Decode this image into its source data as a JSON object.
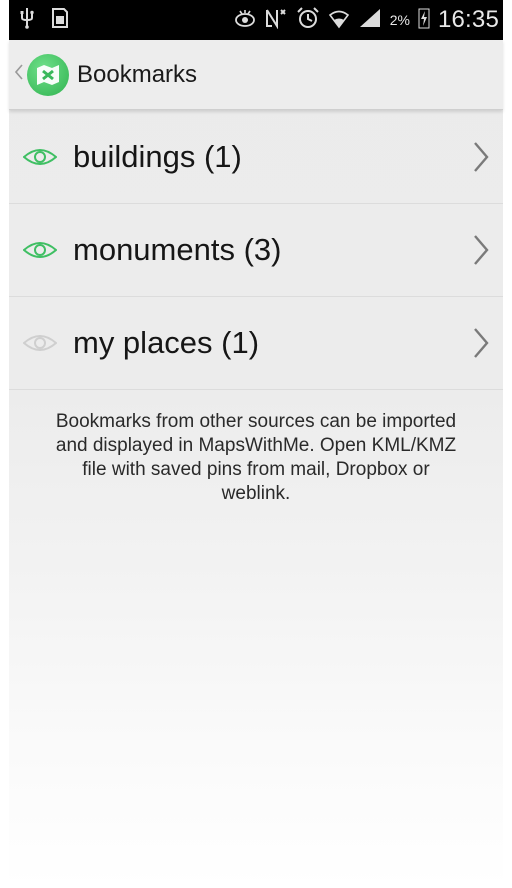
{
  "status_bar": {
    "battery_percent": "2%",
    "time": "16:35",
    "icons": [
      "usb-icon",
      "sd-card-icon",
      "eye-smart-stay-icon",
      "nfc-icon",
      "alarm-icon",
      "wifi-icon",
      "signal-icon",
      "battery-charging-icon"
    ]
  },
  "action_bar": {
    "title": "Bookmarks",
    "app_icon": "mapswithme-icon"
  },
  "bookmark_sets": [
    {
      "label": "buildings (1)",
      "visible": true
    },
    {
      "label": "monuments (3)",
      "visible": true
    },
    {
      "label": "my places (1)",
      "visible": false
    }
  ],
  "info_text": "Bookmarks from other sources can be imported and displayed in MapsWithMe. Open KML/KMZ file with saved pins from mail, Dropbox or weblink.",
  "colors": {
    "eye_visible": "#3fbf63",
    "eye_hidden": "#cfcfcf",
    "status_bar_bg": "#000000",
    "action_bar_bg": "#ededed"
  }
}
